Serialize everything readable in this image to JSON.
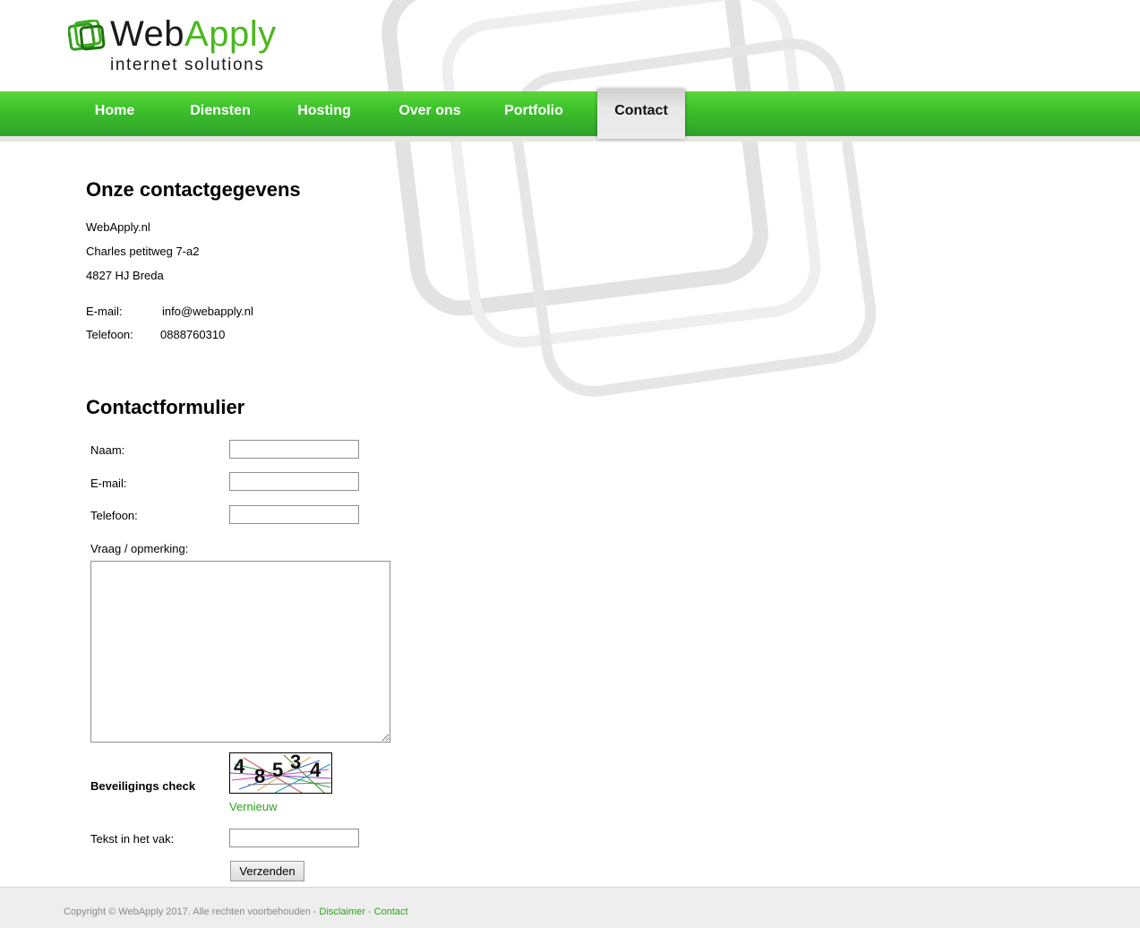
{
  "brand": {
    "name_part1": "Web",
    "name_part2": "Apply",
    "tagline": "internet solutions",
    "accent_color": "#4ab81e"
  },
  "nav": {
    "items": [
      {
        "label": "Home",
        "active": false
      },
      {
        "label": "Diensten",
        "active": false
      },
      {
        "label": "Hosting",
        "active": false
      },
      {
        "label": "Over ons",
        "active": false
      },
      {
        "label": "Portfolio",
        "active": false
      },
      {
        "label": "Contact",
        "active": true
      }
    ]
  },
  "contact": {
    "heading": "Onze contactgegevens",
    "company": "WebApply.nl",
    "street": "Charles petitweg 7-a2",
    "city": "4827 HJ Breda",
    "email_label": "E-mail:",
    "email_value": "info@webapply.nl",
    "phone_label": "Telefoon:",
    "phone_value": "0888760310"
  },
  "form": {
    "heading": "Contactformulier",
    "name_label": "Naam:",
    "email_label": "E-mail:",
    "phone_label": "Telefoon:",
    "question_label": "Vraag / opmerking:",
    "security_label": "Beveiligings check",
    "captcha_chars": [
      "4",
      "8",
      "5",
      "3",
      "4"
    ],
    "refresh_link": "Vernieuw",
    "captcha_input_label": "Tekst in het vak:",
    "submit_label": "Verzenden"
  },
  "footer": {
    "copyright": "Copyright © WebApply 2017. Alle rechten voorbehouden - ",
    "disclaimer_link": "Disclaimer",
    "separator": " - ",
    "contact_link": "Contact"
  }
}
